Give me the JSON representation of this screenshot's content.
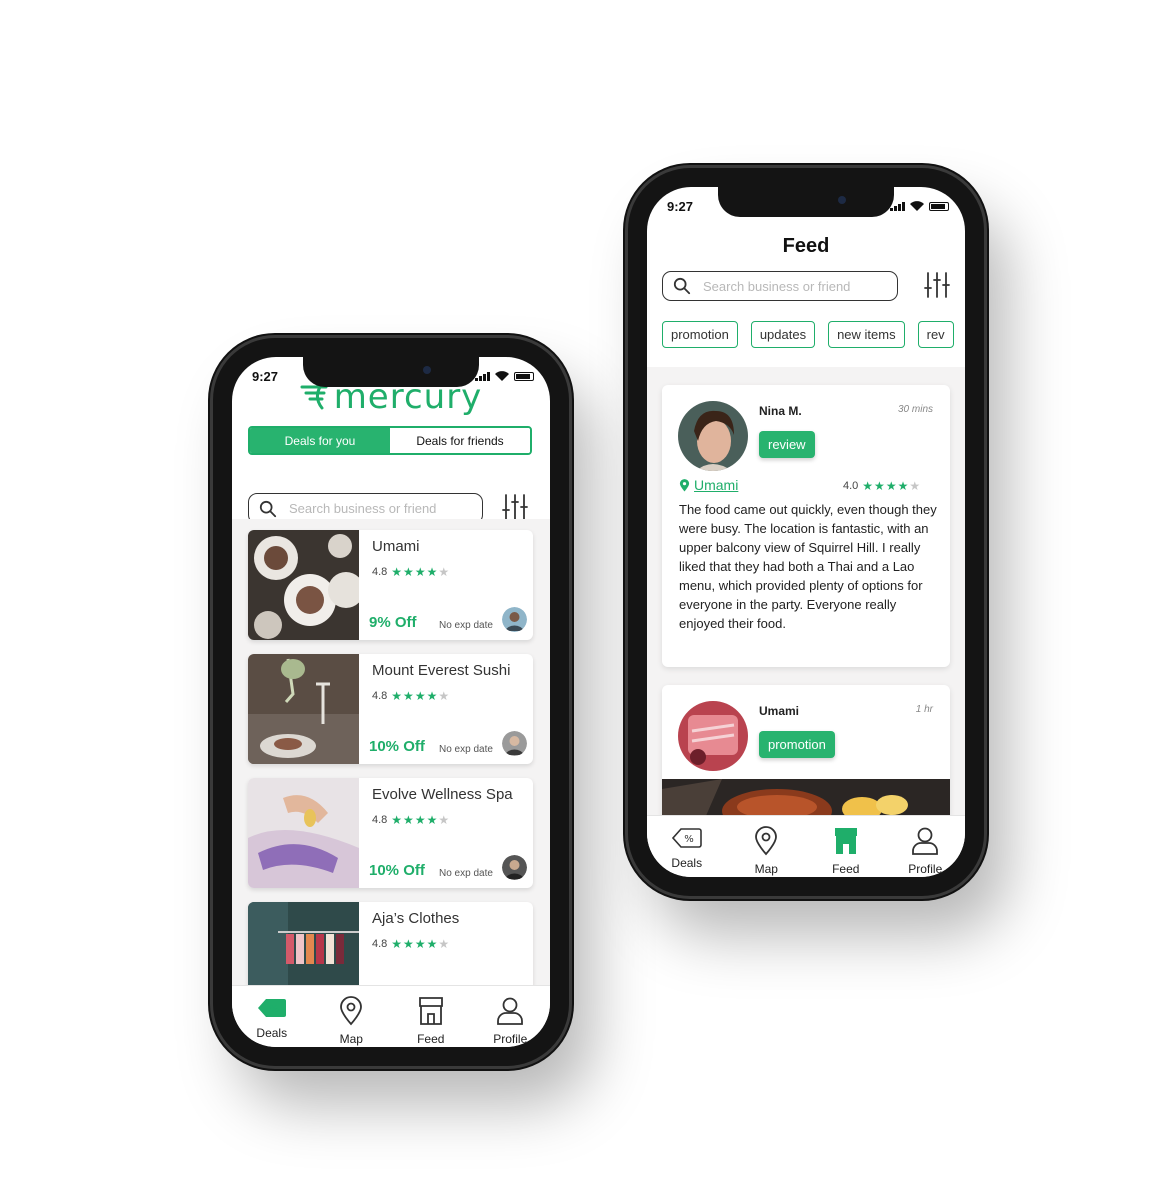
{
  "colors": {
    "accent": "#1fae6a",
    "phone_frame": "#141414",
    "list_background": "#f4f3f3"
  },
  "phone_deals": {
    "status_time": "9:27",
    "brand_logo": "mercury",
    "segmented": {
      "active": "Deals for you",
      "inactive": "Deals for friends"
    },
    "search_placeholder": "Search business or friend",
    "deals": [
      {
        "name": "Umami",
        "rating": "4.8",
        "stars_filled": 4,
        "discount": "9% Off",
        "expiry": "No exp date"
      },
      {
        "name": "Mount Everest Sushi",
        "rating": "4.8",
        "stars_filled": 4,
        "discount": "10% Off",
        "expiry": "No exp date"
      },
      {
        "name": "Evolve Wellness Spa",
        "rating": "4.8",
        "stars_filled": 4,
        "discount": "10% Off",
        "expiry": "No exp date"
      },
      {
        "name": "Aja’s Clothes",
        "rating": "4.8",
        "stars_filled": 4
      }
    ],
    "tabs": [
      {
        "label": "Deals",
        "icon": "deals-tag-icon",
        "active": true
      },
      {
        "label": "Map",
        "icon": "map-pin-icon"
      },
      {
        "label": "Feed",
        "icon": "storefront-icon"
      },
      {
        "label": "Profile",
        "icon": "profile-icon"
      }
    ]
  },
  "phone_feed": {
    "status_time": "9:27",
    "title": "Feed",
    "search_placeholder": "Search business or friend",
    "chips": [
      "promotion",
      "updates",
      "new items",
      "rev"
    ],
    "posts": [
      {
        "author": "Nina M.",
        "time": "30 mins",
        "badge": "review",
        "location": "Umami",
        "rating": "4.0",
        "stars_filled": 4,
        "text": "The food came out quickly, even though they were busy. The location is fantastic, with an upper balcony view of Squirrel Hill. I really liked that they had both a Thai and a Lao menu, which provided plenty of options for everyone in the party. Everyone really enjoyed their food."
      },
      {
        "author": "Umami",
        "time": "1 hr",
        "badge": "promotion"
      }
    ],
    "tabs": [
      {
        "label": "Deals",
        "icon": "deals-tag-icon"
      },
      {
        "label": "Map",
        "icon": "map-pin-icon"
      },
      {
        "label": "Feed",
        "icon": "storefront-icon",
        "active": true
      },
      {
        "label": "Profile",
        "icon": "profile-icon"
      }
    ]
  }
}
